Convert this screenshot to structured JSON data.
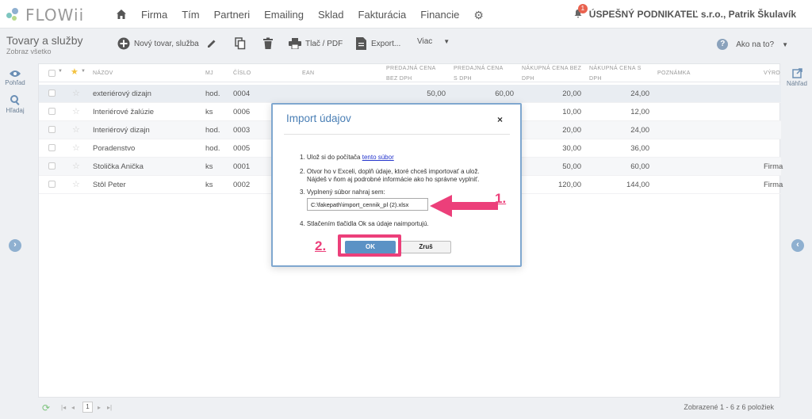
{
  "app": {
    "logo_text": "FLOWii",
    "nav": [
      "Firma",
      "Tím",
      "Partneri",
      "Emailing",
      "Sklad",
      "Fakturácia",
      "Financie"
    ],
    "notification_count": "1",
    "user": "ÚSPEŠNÝ PODNIKATEĽ s.r.o., Patrik Škulavík"
  },
  "toolbar": {
    "title": "Tovary a služby",
    "subtitle": "Zobraz všetko",
    "new_label": "Nový tovar, služba",
    "print_label": "Tlač / PDF",
    "export_label": "Export...",
    "more_label": "Viac",
    "help_label": "Ako na to?"
  },
  "rail": {
    "view_label": "Pohľad",
    "search_label": "Hľadaj",
    "preview_label": "Náhľad"
  },
  "grid": {
    "columns": {
      "name": "NÁZOV",
      "unit": "MJ",
      "number": "ČÍSLO",
      "ean": "EAN",
      "sell_excl_1": "PREDAJNÁ CENA",
      "sell_excl_2": "BEZ DPH",
      "sell_incl_1": "PREDAJNÁ CENA",
      "sell_incl_2": "S DPH",
      "buy_excl_1": "NÁKUPNÁ CENA BEZ",
      "buy_excl_2": "DPH",
      "buy_incl_1": "NÁKUPNÁ CENA S",
      "buy_incl_2": "DPH",
      "note": "POZNÁMKA",
      "maker": "VÝRO"
    },
    "rows": [
      {
        "name": "exteriérový dizajn",
        "unit": "hod.",
        "number": "0004",
        "sell_excl": "50,00",
        "sell_incl": "60,00",
        "buy_excl": "20,00",
        "buy_incl": "24,00",
        "maker": ""
      },
      {
        "name": "Interiérové žalúzie",
        "unit": "ks",
        "number": "0006",
        "sell_excl": "",
        "sell_incl": "",
        "buy_excl": "10,00",
        "buy_incl": "12,00",
        "maker": ""
      },
      {
        "name": "Interiérový dizajn",
        "unit": "hod.",
        "number": "0003",
        "sell_excl": "",
        "sell_incl": "",
        "buy_excl": "20,00",
        "buy_incl": "24,00",
        "maker": ""
      },
      {
        "name": "Poradenstvo",
        "unit": "hod.",
        "number": "0005",
        "sell_excl": "",
        "sell_incl": "",
        "buy_excl": "30,00",
        "buy_incl": "36,00",
        "maker": ""
      },
      {
        "name": "Stolička Anička",
        "unit": "ks",
        "number": "0001",
        "sell_excl": "",
        "sell_incl": "",
        "buy_excl": "50,00",
        "buy_incl": "60,00",
        "maker": "Firma"
      },
      {
        "name": "Stôl Peter",
        "unit": "ks",
        "number": "0002",
        "sell_excl": "",
        "sell_incl": "",
        "buy_excl": "120,00",
        "buy_incl": "144,00",
        "maker": "Firma"
      }
    ]
  },
  "pager": {
    "page": "1",
    "info": "Zobrazené 1 - 6 z 6 položiek"
  },
  "modal": {
    "title": "Import údajov",
    "close": "×",
    "step1_text": "1. Ulož si do počítača ",
    "step1_link": "tento súbor",
    "step2_line1": "2. Otvor ho v Exceli, doplň údaje, ktoré chceš importovať a ulož.",
    "step2_line2": "Nájdeš v ňom aj podrobné informácie ako ho správne vyplniť.",
    "step3_text": "3. Vyplnený súbor nahraj sem:",
    "file_value": "C:\\fakepath\\import_cennik_pl (2).xlsx",
    "step4_text": "4. Stlačením tlačidla Ok sa údaje naimportujú.",
    "ok_label": "OK",
    "cancel_label": "Zruš"
  },
  "annotations": {
    "one": "1.",
    "two": "2."
  },
  "colors": {
    "accent": "#4a7fb5",
    "highlight": "#ec3f7a",
    "ok_button": "#5b92c5"
  }
}
